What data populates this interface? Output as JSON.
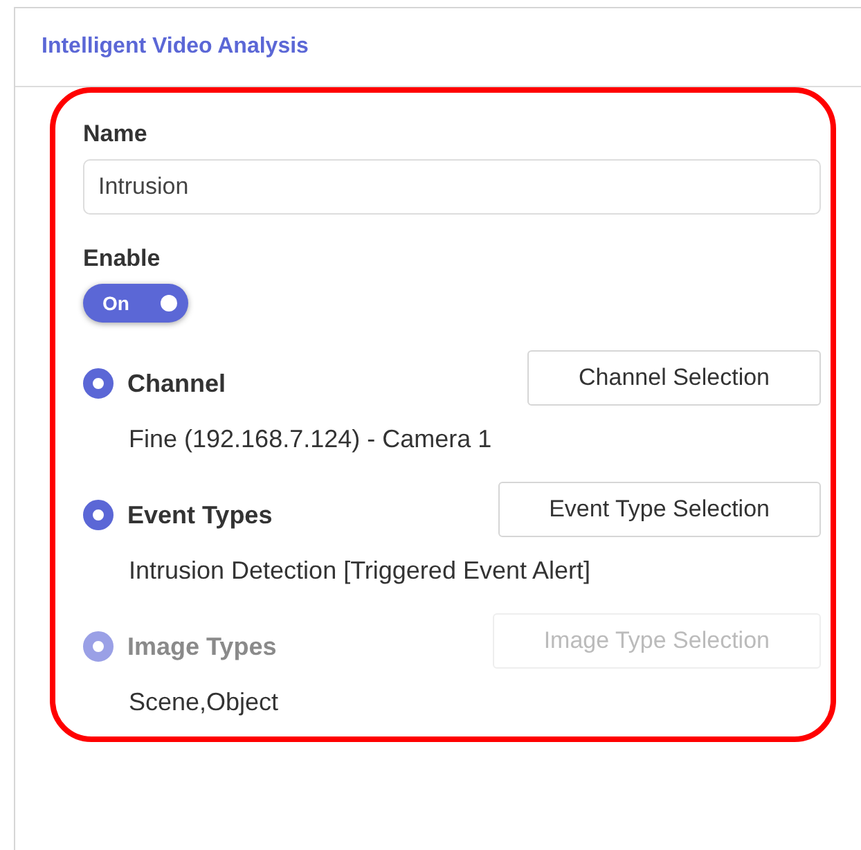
{
  "panel": {
    "title": "Intelligent Video Analysis"
  },
  "name_field": {
    "label": "Name",
    "value": "Intrusion"
  },
  "enable": {
    "label": "Enable",
    "toggle_text": "On",
    "on": true
  },
  "sections": [
    {
      "label": "Channel",
      "selected": true,
      "disabled": false,
      "button": "Channel Selection",
      "value": "Fine (192.168.7.124) - Camera 1"
    },
    {
      "label": "Event Types",
      "selected": true,
      "disabled": false,
      "button": "Event Type Selection",
      "value": "Intrusion Detection [Triggered Event Alert]"
    },
    {
      "label": "Image Types",
      "selected": true,
      "disabled": true,
      "button": "Image Type Selection",
      "value": "Scene,Object"
    }
  ]
}
